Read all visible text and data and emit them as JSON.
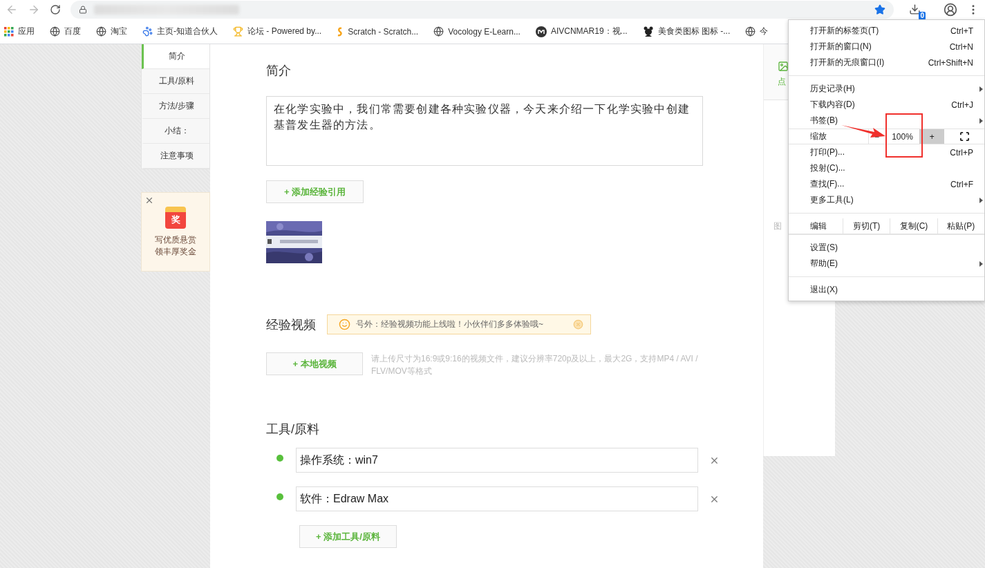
{
  "toolbar": {
    "download_count": "0"
  },
  "bookmarks": [
    {
      "kind": "apps",
      "label": "应用"
    },
    {
      "kind": "globe",
      "label": "百度"
    },
    {
      "kind": "globe",
      "label": "淘宝"
    },
    {
      "kind": "paw",
      "label": "主页-知道合伙人"
    },
    {
      "kind": "trophy",
      "label": "论坛 - Powered by..."
    },
    {
      "kind": "scratch",
      "label": "Scratch - Scratch..."
    },
    {
      "kind": "globe",
      "label": "Vocology E-Learn..."
    },
    {
      "kind": "m",
      "label": "AIVCNMAR19：视..."
    },
    {
      "kind": "panda",
      "label": "美食类图标 图标 -..."
    },
    {
      "kind": "globe",
      "label": "今"
    }
  ],
  "outline": [
    {
      "label": "简介",
      "selected": true
    },
    {
      "label": "工具/原料",
      "selected": false
    },
    {
      "label": "方法/步骤",
      "selected": false
    },
    {
      "label": "小结：",
      "selected": false
    },
    {
      "label": "注意事项",
      "selected": false
    }
  ],
  "reward": {
    "badge": "奖",
    "lines": [
      "写优质悬赏",
      "领丰厚奖金"
    ]
  },
  "intro": {
    "heading": "简介",
    "text": "在化学实验中，我们常需要创建各种实验仪器，今天来介绍一下化学实验中创建基普发生器的方法。",
    "add_button": "+ 添加经验引用"
  },
  "video": {
    "heading": "经验视频",
    "notice": "号外：经验视频功能上线啦！小伙伴们多多体验哦~",
    "upload_button": "+ 本地视频",
    "hint": "请上传尺寸为16:9或9:16的视频文件，建议分辨率720p及以上，最大2G，支持MP4 / AVI / FLV/MOV等格式"
  },
  "tools": {
    "heading": "工具/原料",
    "items": [
      {
        "value": "操作系统：win7"
      },
      {
        "value": "软件：Edraw Max"
      }
    ],
    "add_button": "+ 添加工具/原料"
  },
  "side_panel": {
    "link": "点",
    "label": "图"
  },
  "menu": {
    "rows": [
      {
        "kind": "item",
        "label": "打开新的标签页(T)",
        "shortcut": "Ctrl+T",
        "submenu": false
      },
      {
        "kind": "item",
        "label": "打开新的窗口(N)",
        "shortcut": "Ctrl+N",
        "submenu": false
      },
      {
        "kind": "item",
        "label": "打开新的无痕窗口(I)",
        "shortcut": "Ctrl+Shift+N",
        "submenu": false
      },
      {
        "kind": "separator"
      },
      {
        "kind": "item",
        "label": "历史记录(H)",
        "submenu": true
      },
      {
        "kind": "item",
        "label": "下载内容(D)",
        "shortcut": "Ctrl+J",
        "submenu": false
      },
      {
        "kind": "item",
        "label": "书签(B)",
        "submenu": true
      },
      {
        "kind": "zoom",
        "label": "缩放",
        "minus": "−",
        "value": "100%",
        "plus": "+",
        "plus_highlighted": true
      },
      {
        "kind": "item",
        "label": "打印(P)...",
        "shortcut": "Ctrl+P",
        "submenu": false
      },
      {
        "kind": "item",
        "label": "投射(C)...",
        "submenu": false
      },
      {
        "kind": "item",
        "label": "查找(F)...",
        "shortcut": "Ctrl+F",
        "submenu": false
      },
      {
        "kind": "item",
        "label": "更多工具(L)",
        "submenu": true
      },
      {
        "kind": "edit",
        "label": "编辑",
        "actions": [
          "剪切(T)",
          "复制(C)",
          "粘贴(P)"
        ]
      },
      {
        "kind": "item",
        "label": "设置(S)",
        "submenu": false
      },
      {
        "kind": "item",
        "label": "帮助(E)",
        "submenu": true
      },
      {
        "kind": "separator"
      },
      {
        "kind": "item",
        "label": "退出(X)",
        "submenu": false
      }
    ]
  }
}
